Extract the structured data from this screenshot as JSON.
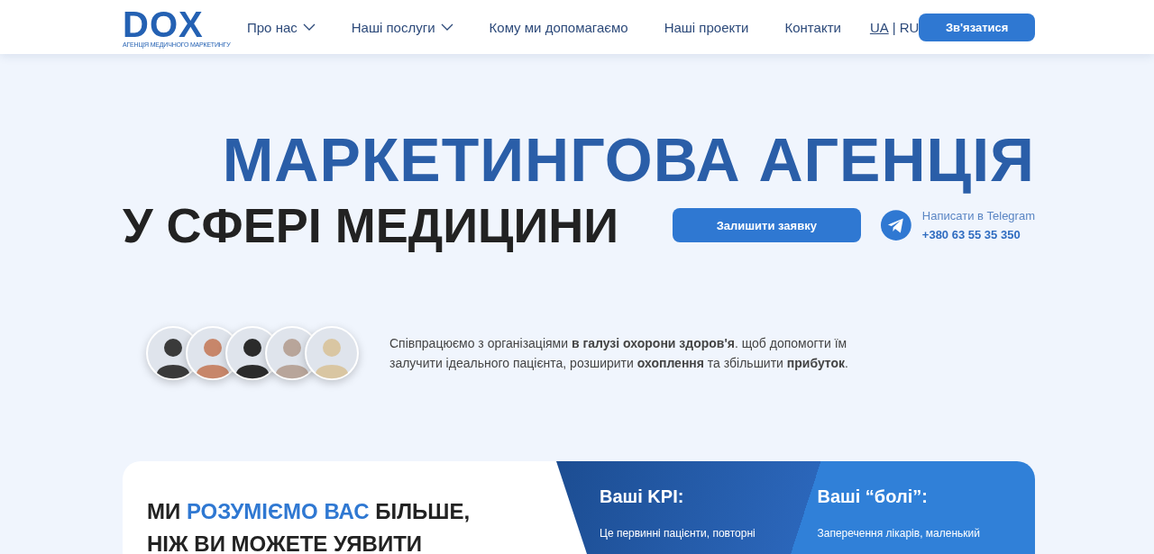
{
  "logo": {
    "mark": "DOX",
    "tagline": "АГЕНЦІЯ МЕДИЧНОГО МАРКЕТИНГУ"
  },
  "nav": [
    {
      "label": "Про нас",
      "dropdown": true
    },
    {
      "label": "Наші послуги",
      "dropdown": true
    },
    {
      "label": "Кому ми допомагаємо",
      "dropdown": false
    },
    {
      "label": "Наші проекти",
      "dropdown": false
    },
    {
      "label": "Контакти",
      "dropdown": false
    }
  ],
  "languages": [
    {
      "label": "UA",
      "selected": true
    },
    {
      "label": "RU",
      "selected": false
    }
  ],
  "language_separator": "|",
  "header_button": "Зв'язатися",
  "hero": {
    "title_line_1": "МАРКЕТИНГОВА АГЕНЦІЯ",
    "title_line_2": "У СФЕРІ МЕДИЦИНИ",
    "button": "Залишити заявку",
    "telegram_label": "Написати в Telegram",
    "phone": "+380 63 55 35 350"
  },
  "intro": "Співпрацюємо з організаціями **в галузі охорони здоров'я**. щоб допомогти їм залучити ідеального пацієнта, розширити **охоплення** та збільшити **прибуток**.",
  "card": {
    "heading_parts": [
      {
        "text": "МИ ",
        "highlight": false
      },
      {
        "text": "РОЗУМІЄМО ВАС",
        "highlight": true
      },
      {
        "text": " БІЛЬШЕ,",
        "highlight": false
      }
    ],
    "heading_line_2": "НІЖ ВИ МОЖЕТЕ УЯВИТИ",
    "panels": [
      {
        "title": "Ваші KPI:",
        "text": "Це первинні пацієнти, повторні"
      },
      {
        "title": "Ваші “болі”:",
        "text": "Заперечення лікарів, маленький"
      }
    ]
  }
}
